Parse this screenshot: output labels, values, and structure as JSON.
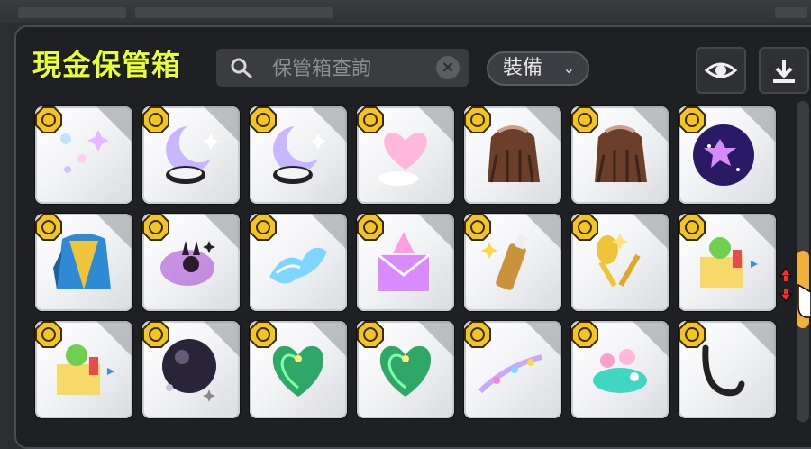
{
  "window": {
    "title": "現金保管箱"
  },
  "search": {
    "placeholder": "保管箱查詢",
    "clear_label": "×"
  },
  "filter": {
    "label": "裝備",
    "chevron": "⌄"
  },
  "toolbar": {
    "view_icon": "eye-icon",
    "download_icon": "download-icon"
  },
  "colors": {
    "title": "#e6ff3a",
    "scroll_thumb": "#f0b13a",
    "coin": "#f2c521"
  },
  "inventory": {
    "rows": 3,
    "cols": 7,
    "items": [
      {
        "icon": "sparkle-effect-icon"
      },
      {
        "icon": "moon-cloud-icon"
      },
      {
        "icon": "moon-cloud-icon"
      },
      {
        "icon": "heart-cloud-icon"
      },
      {
        "icon": "brown-hair-icon"
      },
      {
        "icon": "brown-hair-icon"
      },
      {
        "icon": "purple-galaxy-orb-icon"
      },
      {
        "icon": "blue-coat-icon"
      },
      {
        "icon": "bunny-sparkle-icon"
      },
      {
        "icon": "blue-wings-icon"
      },
      {
        "icon": "pink-envelope-icon"
      },
      {
        "icon": "bottle-icon"
      },
      {
        "icon": "spoon-fork-icon"
      },
      {
        "icon": "gift-box-icon"
      },
      {
        "icon": "gift-box-icon"
      },
      {
        "icon": "dark-orb-icon"
      },
      {
        "icon": "green-heart-icon"
      },
      {
        "icon": "green-heart-icon"
      },
      {
        "icon": "sparkle-trail-icon"
      },
      {
        "icon": "teal-flower-icon"
      },
      {
        "icon": "black-tail-icon"
      }
    ]
  }
}
